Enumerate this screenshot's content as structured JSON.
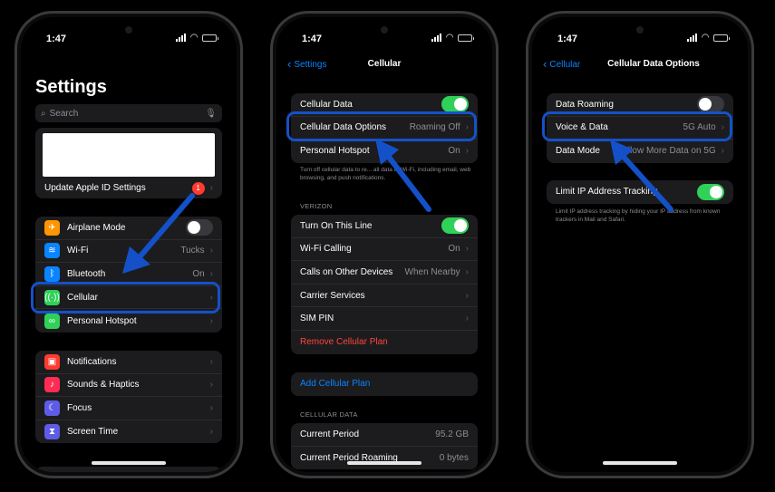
{
  "colors": {
    "accent": "#0a84ff",
    "toggle_on": "#30d158",
    "destructive": "#ff453a",
    "highlight": "#1451c9"
  },
  "phone1": {
    "time": "1:47",
    "title": "Settings",
    "search_placeholder": "Search",
    "apple_id_label": "Update Apple ID Settings",
    "apple_id_badge": "1",
    "connectivity": [
      {
        "label": "Airplane Mode",
        "icon": "airplane-icon",
        "color": "#ff9500",
        "toggle": "off"
      },
      {
        "label": "Wi-Fi",
        "icon": "wifi-icon",
        "color": "#0a84ff",
        "value": "Tucks"
      },
      {
        "label": "Bluetooth",
        "icon": "bluetooth-icon",
        "color": "#0a84ff",
        "value": "On"
      },
      {
        "label": "Cellular",
        "icon": "antenna-icon",
        "color": "#30d158",
        "value": ""
      },
      {
        "label": "Personal Hotspot",
        "icon": "link-icon",
        "color": "#30d158",
        "value": ""
      }
    ],
    "general": [
      {
        "label": "Notifications",
        "icon": "bell-icon",
        "color": "#ff3b30"
      },
      {
        "label": "Sounds & Haptics",
        "icon": "speaker-icon",
        "color": "#ff2d55"
      },
      {
        "label": "Focus",
        "icon": "moon-icon",
        "color": "#5e5ce6"
      },
      {
        "label": "Screen Time",
        "icon": "hourglass-icon",
        "color": "#5e5ce6"
      }
    ]
  },
  "phone2": {
    "time": "1:47",
    "back_label": "Settings",
    "title": "Cellular",
    "top_group": [
      {
        "label": "Cellular Data",
        "toggle": "on"
      },
      {
        "label": "Cellular Data Options",
        "value": "Roaming Off"
      },
      {
        "label": "Personal Hotspot",
        "value": "On"
      }
    ],
    "top_footnote": "Turn off cellular data to re... all data to Wi-Fi, including email, web browsing, and push notifications.",
    "carrier_section": "VERIZON",
    "carrier_group": [
      {
        "label": "Turn On This Line",
        "toggle": "on"
      },
      {
        "label": "Wi-Fi Calling",
        "value": "On"
      },
      {
        "label": "Calls on Other Devices",
        "value": "When Nearby"
      },
      {
        "label": "Carrier Services",
        "value": ""
      },
      {
        "label": "SIM PIN",
        "value": ""
      },
      {
        "label": "Remove Cellular Plan",
        "value": "",
        "style": "danger"
      }
    ],
    "add_plan_label": "Add Cellular Plan",
    "data_section": "CELLULAR DATA",
    "data_group": [
      {
        "label": "Current Period",
        "value": "95.2 GB"
      },
      {
        "label": "Current Period Roaming",
        "value": "0 bytes"
      }
    ]
  },
  "phone3": {
    "time": "1:47",
    "back_label": "Cellular",
    "title": "Cellular Data Options",
    "top_group": [
      {
        "label": "Data Roaming",
        "toggle": "off"
      },
      {
        "label": "Voice & Data",
        "value": "5G Auto"
      },
      {
        "label": "Data Mode",
        "value": "Allow More Data on 5G"
      }
    ],
    "tracking_label": "Limit IP Address Tracking",
    "tracking_toggle": "on",
    "tracking_footnote": "Limit IP address tracking by hiding your IP address from known trackers in Mail and Safari."
  }
}
